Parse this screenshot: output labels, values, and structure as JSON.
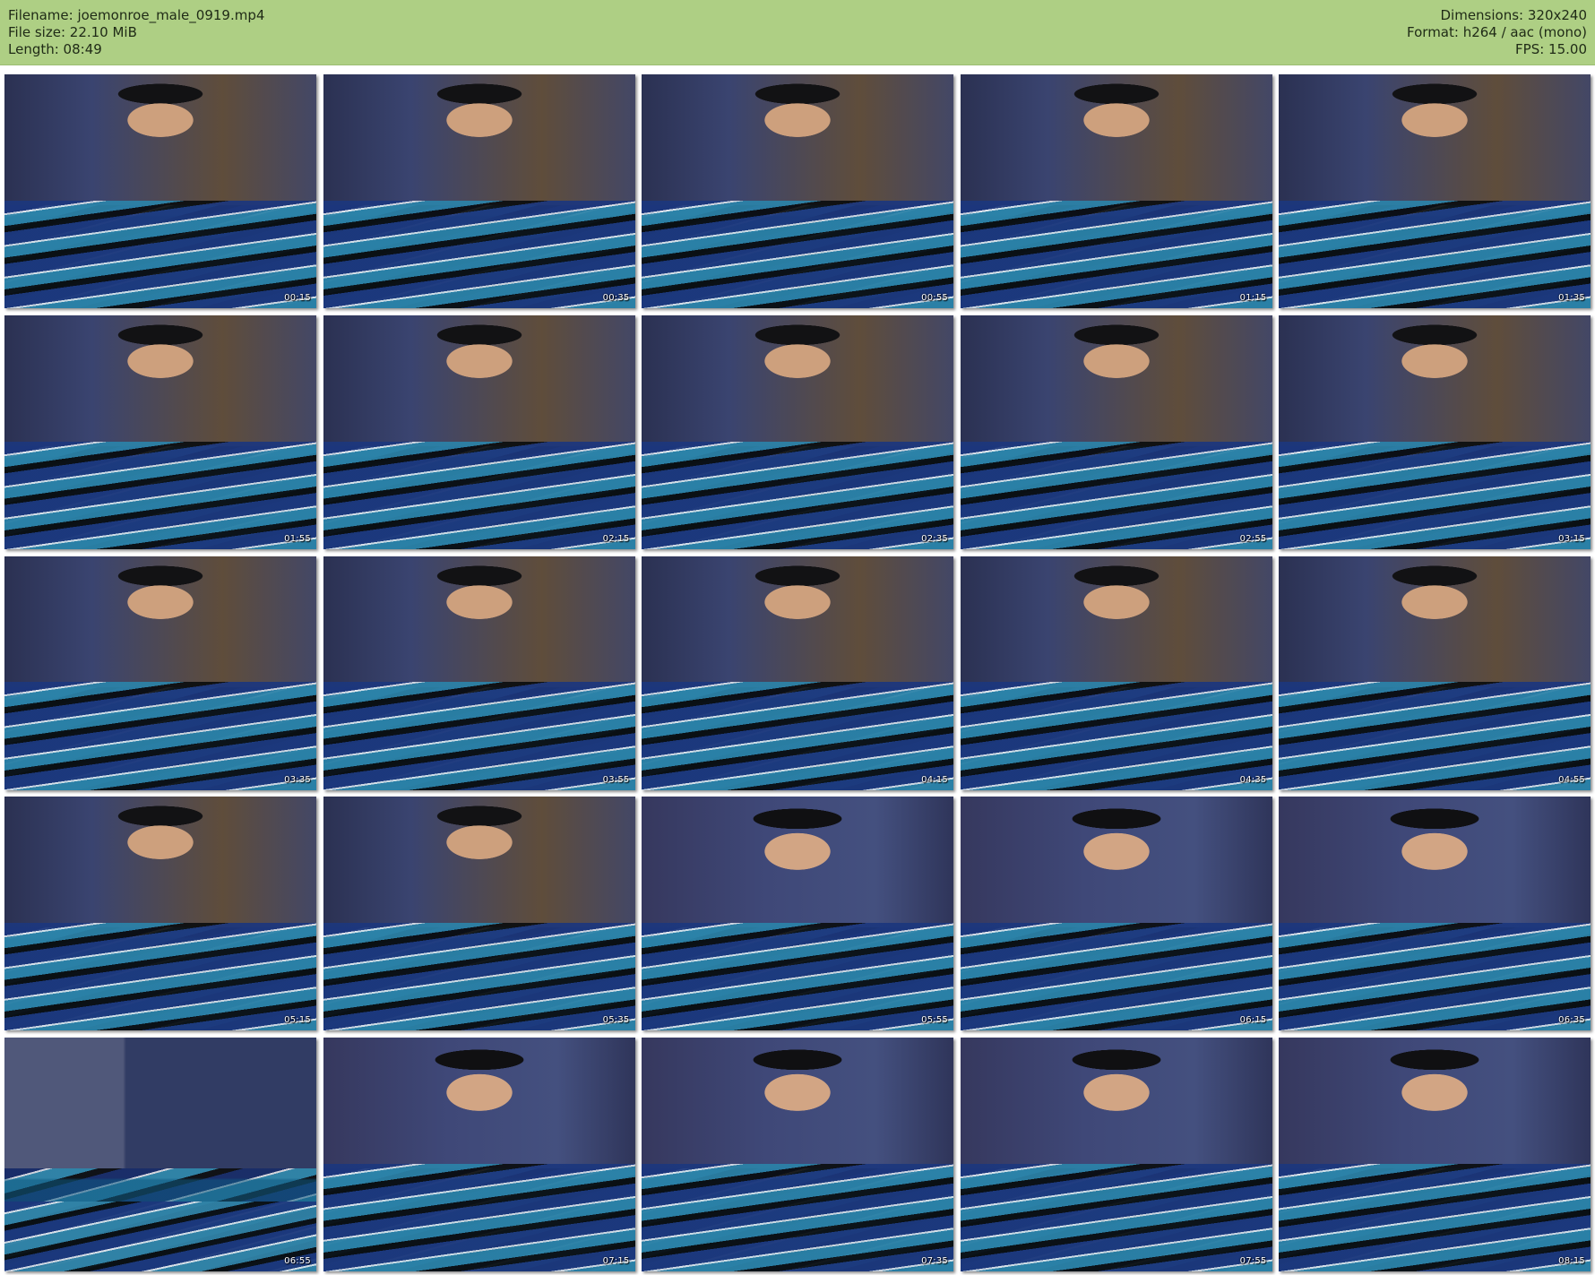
{
  "header": {
    "left": {
      "filename": "Filename: joemonroe_male_0919.mp4",
      "file_size": "File size: 22.10 MiB",
      "length": "Length: 08:49"
    },
    "right": {
      "dimensions": "Dimensions: 320x240",
      "format": "Format: h264 / aac (mono)",
      "fps": "FPS: 15.00"
    }
  },
  "thumbnails": [
    {
      "time": "00:15"
    },
    {
      "time": "00:35"
    },
    {
      "time": "00:55"
    },
    {
      "time": "01:15"
    },
    {
      "time": "01:35"
    },
    {
      "time": "01:55"
    },
    {
      "time": "02:15"
    },
    {
      "time": "02:35"
    },
    {
      "time": "02:55"
    },
    {
      "time": "03:15"
    },
    {
      "time": "03:35"
    },
    {
      "time": "03:55"
    },
    {
      "time": "04:15"
    },
    {
      "time": "04:35"
    },
    {
      "time": "04:55"
    },
    {
      "time": "05:15"
    },
    {
      "time": "05:35"
    },
    {
      "time": "05:55"
    },
    {
      "time": "06:15"
    },
    {
      "time": "06:35"
    },
    {
      "time": "06:55"
    },
    {
      "time": "07:15"
    },
    {
      "time": "07:35"
    },
    {
      "time": "07:55"
    },
    {
      "time": "08:15"
    }
  ],
  "colors": {
    "header_background": "#aecf84",
    "page_background": "#ffffff",
    "timestamp_text": "#ffffff"
  }
}
